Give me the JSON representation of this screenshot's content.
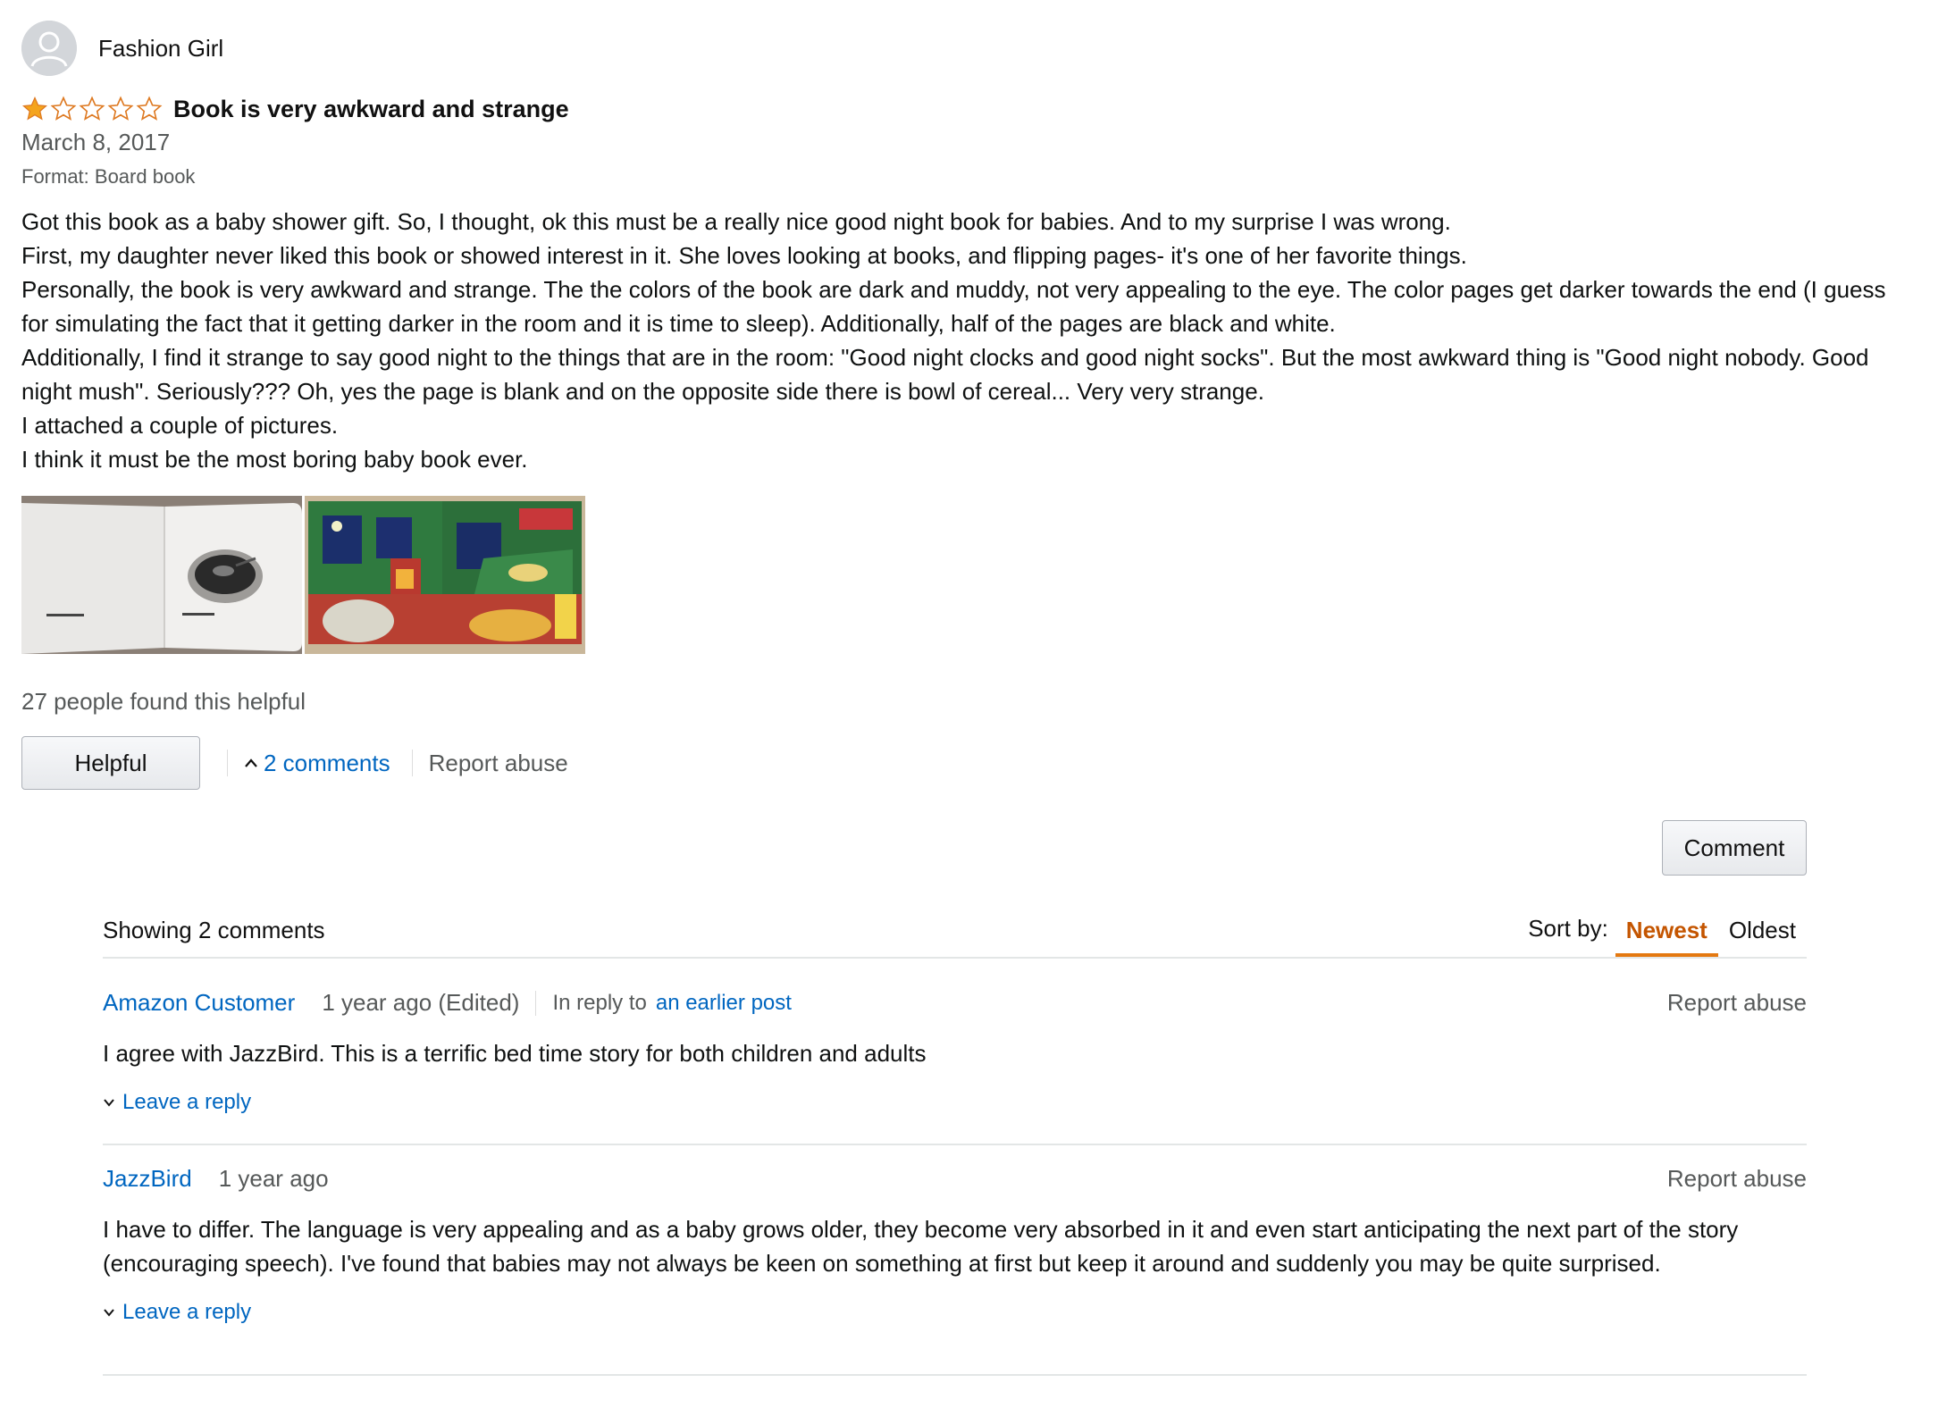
{
  "reviewer": {
    "name": "Fashion Girl"
  },
  "review": {
    "rating": 1,
    "rating_max": 5,
    "title": "Book is very awkward and strange",
    "date": "March 8, 2017",
    "format": "Format: Board book",
    "body": [
      "Got this book as a baby shower gift. So, I thought, ok this must be a really nice good night book for babies. And to my surprise I was wrong.",
      "First, my daughter never liked this book or showed interest in it. She loves looking at books, and flipping pages- it's one of her favorite things.",
      "Personally, the book is very awkward and strange. The the colors of the book are dark and muddy, not very appealing to the eye. The color pages get darker towards the end (I guess for simulating the fact that it getting darker in the room and it is time to sleep). Additionally, half of the pages are black and white.",
      "Additionally, I find it strange to say good night to the things that are in the room: \"Good night clocks and good night socks\". But the most awkward thing is \"Good night nobody. Good night mush\". Seriously??? Oh, yes the page is blank and on the opposite side there is bowl of cereal... Very very strange.",
      "I attached a couple of pictures.",
      "I think it must be the most boring baby book ever."
    ],
    "helpful_count": "27 people found this helpful",
    "helpful_button": "Helpful",
    "comments_toggle": "2 comments",
    "report_abuse": "Report abuse"
  },
  "comment_button": "Comment",
  "comments_section": {
    "showing": "Showing 2 comments",
    "sort_label": "Sort by:",
    "sort_options": [
      "Newest",
      "Oldest"
    ],
    "comments": [
      {
        "author": "Amazon Customer",
        "time": "1 year ago (Edited)",
        "in_reply_label": "In reply to",
        "in_reply_link": "an earlier post",
        "report": "Report abuse",
        "text": "I agree with JazzBird. This is a terrific bed time story for both children and adults",
        "reply": "Leave a reply"
      },
      {
        "author": "JazzBird",
        "time": "1 year ago",
        "report": "Report abuse",
        "text": "I have to differ. The language is very appealing and as a baby grows older, they become very absorbed in it and even start anticipating the next part of the story (encouraging speech). I've found that babies may not always be keen on something at first but keep it around and suddenly you may be quite surprised.",
        "reply": "Leave a reply"
      }
    ]
  },
  "colors": {
    "link": "#0066c0",
    "star": "#f4a41d",
    "sort_active": "#c45500",
    "muted": "#565959"
  }
}
